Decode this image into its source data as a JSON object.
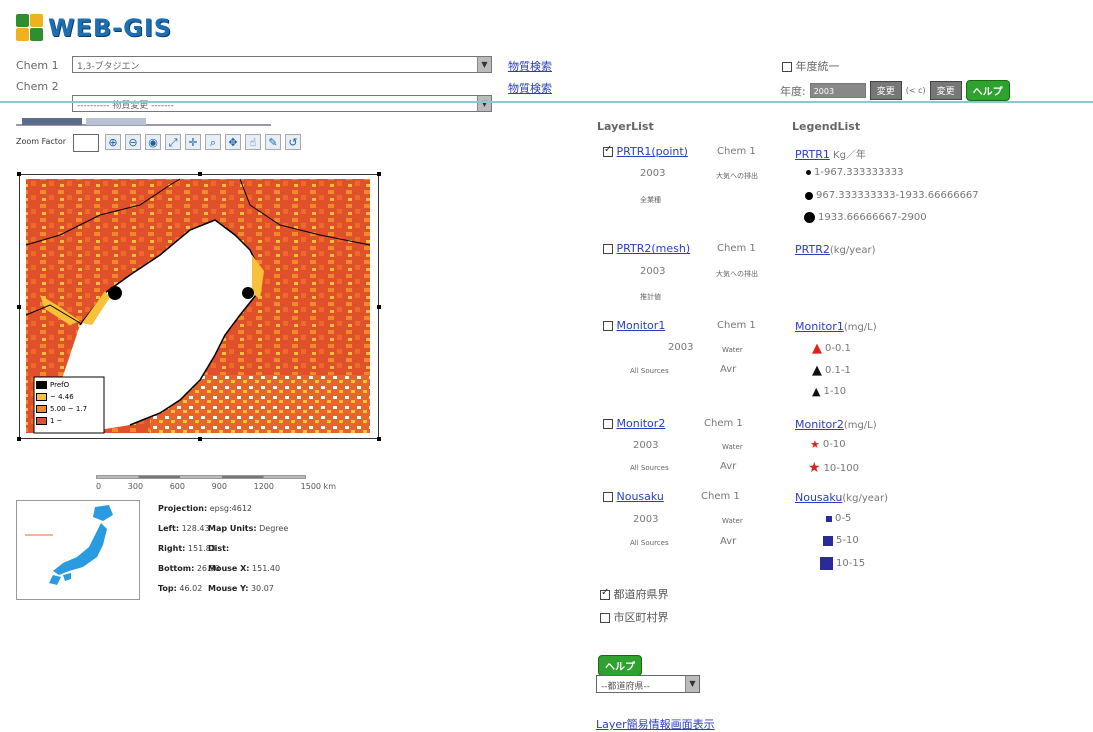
{
  "header": {
    "logo_text": "WEB-GIS",
    "chem1_label": "Chem 1",
    "chem1_value": "1,3-ブタジエン",
    "chem2_label": "Chem 2",
    "chem2_value": "---------- 物質変更 -------",
    "search_link": "物質検索",
    "year_unify_label": "年度統一",
    "year_label": "年度:",
    "year_value": "2003",
    "apply_button": "変更",
    "range_text": "(< c)",
    "apply_button2": "変更",
    "help_button": "ヘルプ"
  },
  "toolbar": {
    "zoom_factor_label": "Zoom Factor",
    "tools": [
      "zoom-in-icon",
      "zoom-out-icon",
      "zoom-full-icon",
      "extent-icon",
      "pan-cross-icon",
      "find-icon",
      "identify-icon",
      "hand-icon",
      "measure-icon",
      "refresh-icon"
    ]
  },
  "map": {
    "legend": [
      "PrefO",
      "~ 4.46",
      "5.00 ~ 1.7",
      "1 ~"
    ],
    "scale_labels": [
      "0",
      "300",
      "600",
      "900",
      "1200",
      "1500 km"
    ]
  },
  "map_info": {
    "projection_label": "Projection:",
    "projection_value": "epsg:4612",
    "left_label": "Left:",
    "left_value": "128.43",
    "map_units_label": "Map Units:",
    "map_units_value": "Degree",
    "right_label": "Right:",
    "right_value": "151.83",
    "dist_label": "Dist:",
    "bottom_label": "Bottom:",
    "bottom_value": "26.90",
    "mouse_x_label": "Mouse X:",
    "mouse_x_value": "151.40",
    "top_label": "Top:",
    "top_value": "46.02",
    "mouse_y_label": "Mouse Y:",
    "mouse_y_value": "30.07"
  },
  "panel": {
    "layer_list_title": "LayerList",
    "legend_list_title": "LegendList",
    "layers": [
      {
        "name": "PRTR1(point)",
        "chem": "Chem 1",
        "year": "2003",
        "detail": "大気への排出",
        "sub": "全業種",
        "checked": true,
        "legend_title": "PRTR1",
        "legend_unit": " Kg／年",
        "legend_items": [
          "1-967.333333333",
          "967.333333333-1933.66666667",
          "1933.66666667-2900"
        ]
      },
      {
        "name": "PRTR2(mesh)",
        "chem": "Chem 1",
        "year": "2003",
        "detail": "大気への排出",
        "sub": "推計値",
        "checked": false,
        "legend_title": "PRTR2",
        "legend_unit": "(kg/year)",
        "legend_items": []
      },
      {
        "name": "Monitor1",
        "chem": "Chem 1",
        "year": "2003",
        "detail": "Water",
        "sub": "All Sources",
        "extra": "Avr",
        "checked": false,
        "legend_title": "Monitor1",
        "legend_unit": "(mg/L)",
        "legend_items": [
          "0-0.1",
          "0.1-1",
          "1-10"
        ]
      },
      {
        "name": "Monitor2",
        "chem": "Chem 1",
        "year": "2003",
        "detail": "Water",
        "sub": "All Sources",
        "extra": "Avr",
        "checked": false,
        "legend_title": "Monitor2",
        "legend_unit": "(mg/L)",
        "legend_items": [
          "0-10",
          "10-100"
        ]
      },
      {
        "name": "Nousaku",
        "chem": "Chem 1",
        "year": "2003",
        "detail": "Water",
        "sub": "All Sources",
        "extra": "Avr",
        "checked": false,
        "legend_title": "Nousaku",
        "legend_unit": "(kg/year)",
        "legend_items": [
          "0-5",
          "5-10",
          "10-15"
        ]
      }
    ],
    "boundary1": "都道府県界",
    "boundary2": "市区町村界",
    "help_button": "ヘルプ",
    "pref_select": "--都道府県--",
    "bottom_link": "Layer簡易情報画面表示"
  },
  "colors": {
    "map_dark": "#e0502a",
    "map_mid": "#f08a2a",
    "map_light": "#f7c23a",
    "accent_line": "#8cc9cf",
    "link": "#2a3dbf"
  }
}
